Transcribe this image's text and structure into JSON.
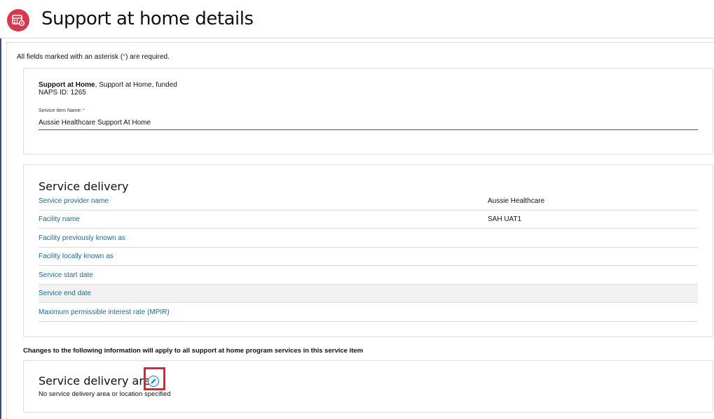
{
  "header": {
    "title": "Support at home details",
    "icon": "calendar-gear-icon",
    "icon_color": "#d73a4f"
  },
  "required_note": {
    "prefix": "All fields marked with an asterisk (",
    "star": "*",
    "suffix": ") are required."
  },
  "service_item": {
    "program_bold": "Support at Home",
    "program_rest": ", Support at Home, funded",
    "naps_id": "NAPS ID: 1265",
    "name_label": "Service Item Name:",
    "name_required": "*",
    "name_value": "Aussie Healthcare Support At Home"
  },
  "service_delivery": {
    "title": "Service delivery",
    "rows": [
      {
        "label": "Service provider name",
        "value": "Aussie Healthcare"
      },
      {
        "label": "Facility name",
        "value": "SAH UAT1"
      },
      {
        "label": "Facility previously known as",
        "value": ""
      },
      {
        "label": "Facility locally known as",
        "value": ""
      },
      {
        "label": "Service start date",
        "value": ""
      },
      {
        "label": "Service end date",
        "value": ""
      },
      {
        "label": "Maximum permissible interest rate (MPIR)",
        "value": ""
      }
    ]
  },
  "changes_note": "Changes to the following information will apply to all support at home program services in this service item",
  "service_delivery_area": {
    "title": "Service delivery area",
    "edit_icon": "pencil-icon",
    "empty_text": "No service delivery area or location specified",
    "highlight_color": "#e0262a"
  }
}
